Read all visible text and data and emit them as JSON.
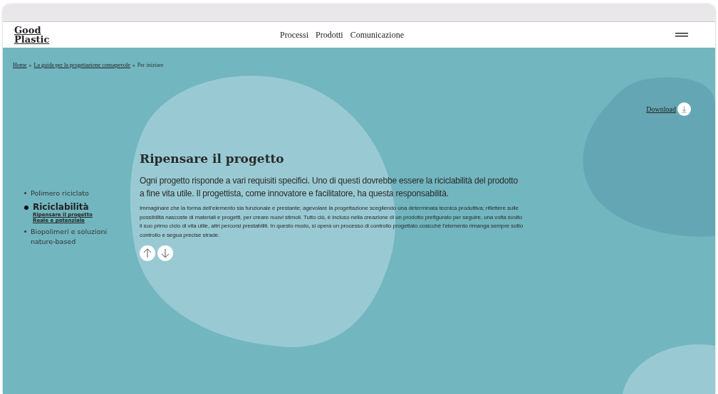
{
  "logo": "Good Plastic",
  "nav": [
    "Processi",
    "Prodotti",
    "Comunicazione"
  ],
  "breadcrumb": [
    {
      "label": "Home",
      "link": true
    },
    {
      "label": "La guida per la progettazione consapevole",
      "link": true
    },
    {
      "label": "Per iniziare",
      "link": false
    }
  ],
  "breadcrumb_separator": "»",
  "download": {
    "label": "Download"
  },
  "sidebar": [
    {
      "label": "Polimero riciclato",
      "selected": false
    },
    {
      "label": "Riciclabilità",
      "selected": true,
      "children": [
        {
          "label": "Ripensare il progetto"
        },
        {
          "label": "Reale e potenziale"
        }
      ]
    },
    {
      "label": "Biopolimeri e soluzioni nature-based",
      "selected": false
    }
  ],
  "content": {
    "title": "Ripensare il progetto",
    "lead": "Ogni progetto risponde a vari requisiti specifici. Uno di questi dovrebbe essere la riciclabilità del prodotto a fine vita utile. Il progettista, come innovatore e facilitatore, ha questa responsabilità.",
    "body": "Immaginare che la forma dell’elemento sia funzionale e prestante; agevolare la progettazione scegliendo una determinata tecnica produttiva; riflettere sulle possibilità nascoste di materiali e progetti, per creare nuovi stimoli. Tutto ciò, è incluso nella creazione di un prodotto prefigurato per seguire, una volta svolto il suo primo ciclo di vita utile, altri percorsi prestabiliti. In questo modo, si opera un processo di controllo progettato cosicché l’elemento rimanga sempre sotto controllo e segua precise strade."
  }
}
